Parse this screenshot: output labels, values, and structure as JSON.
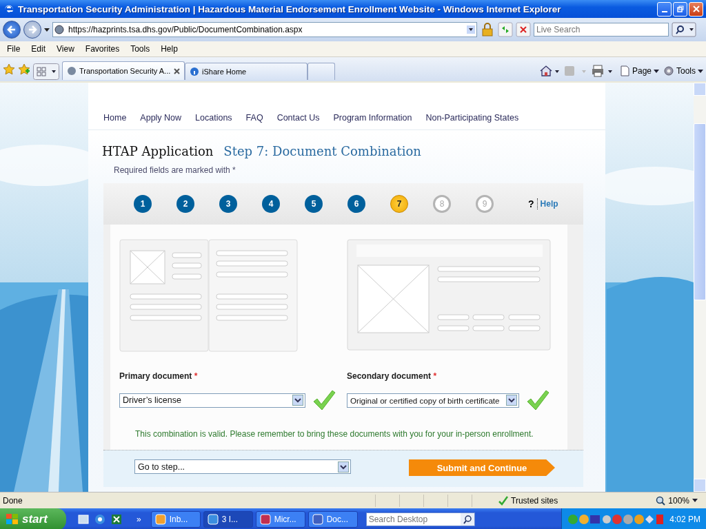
{
  "window": {
    "title": "Transportation Security Administration | Hazardous Material Endorsement Enrollment Website - Windows Internet Explorer"
  },
  "address_bar": {
    "url": "https://hazprints.tsa.dhs.gov/Public/DocumentCombination.aspx"
  },
  "search": {
    "placeholder": "Live Search"
  },
  "menu": [
    "File",
    "Edit",
    "View",
    "Favorites",
    "Tools",
    "Help"
  ],
  "tabs": [
    {
      "label": "Transportation Security A...",
      "selected": true
    },
    {
      "label": "iShare Home",
      "selected": false
    }
  ],
  "command_bar": [
    "Page",
    "Tools"
  ],
  "site_nav": [
    "Home",
    "Apply Now",
    "Locations",
    "FAQ",
    "Contact Us",
    "Program Information",
    "Non-Participating States"
  ],
  "page": {
    "title": "HTAP Application",
    "step_title": "Step 7: Document Combination",
    "required_note": "Required fields are marked with *"
  },
  "steps": [
    {
      "label": "1",
      "completed": true,
      "selected": false
    },
    {
      "label": "2",
      "completed": true,
      "selected": false
    },
    {
      "label": "3",
      "completed": true,
      "selected": false
    },
    {
      "label": "4",
      "completed": true,
      "selected": false
    },
    {
      "label": "5",
      "completed": true,
      "selected": false
    },
    {
      "label": "6",
      "completed": true,
      "selected": false
    },
    {
      "label": "7",
      "completed": false,
      "selected": true
    },
    {
      "label": "8",
      "completed": false,
      "selected": false
    },
    {
      "label": "9",
      "completed": false,
      "selected": false
    }
  ],
  "help": {
    "mark": "?",
    "label": "Help"
  },
  "documents": [
    {
      "label": "Primary document",
      "required_mark": "*",
      "value": "Driver’s license",
      "valid": true
    },
    {
      "label": "Secondary document",
      "required_mark": "*",
      "value": "Original or certified copy of birth certificate",
      "valid": true
    }
  ],
  "message": "This combination is valid. Please remember to bring these documents with you for your in-person enrollment.",
  "step_select": {
    "value": "Go to step..."
  },
  "submit_button": "Submit and Continue",
  "status_bar": {
    "text": "Done",
    "zone": "Trusted sites",
    "zoom": "100%"
  },
  "taskbar": {
    "start": "start",
    "more": "»",
    "tasks": [
      {
        "label": "Inb...",
        "selected": false
      },
      {
        "label": "3 I...",
        "selected": true
      },
      {
        "label": "Micr...",
        "selected": false
      },
      {
        "label": "Doc...",
        "selected": false
      }
    ],
    "search": {
      "placeholder": "Search Desktop"
    },
    "clock": "4:02 PM"
  }
}
